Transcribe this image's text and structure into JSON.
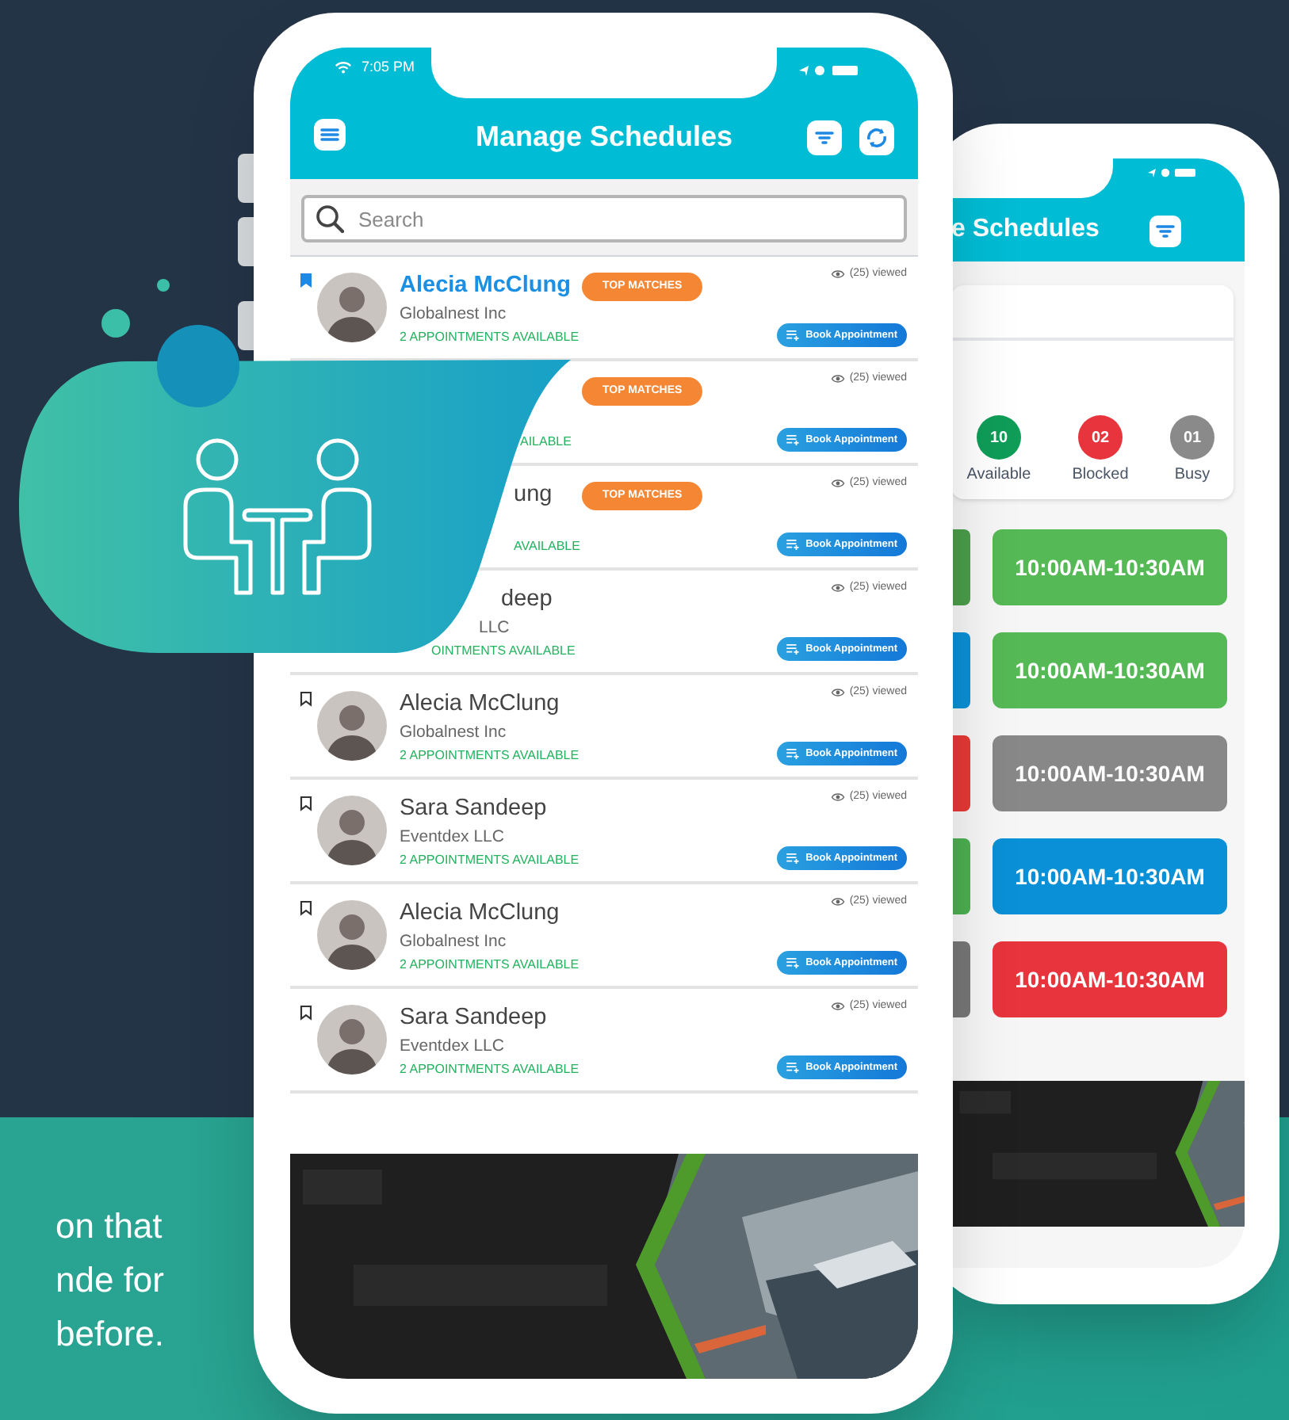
{
  "status_bar": {
    "time": "7:05 PM"
  },
  "header": {
    "title": "Manage Schedules"
  },
  "search": {
    "placeholder": "Search"
  },
  "contacts": [
    {
      "kind": "full",
      "bookmarked": true,
      "selected": true,
      "name": "Alecia McClung",
      "company": "Globalnest Inc",
      "appointments": "2 APPOINTMENTS AVAILABLE",
      "badge": "TOP MATCHES",
      "views": "(25) viewed",
      "action": "Book Appointment"
    },
    {
      "kind": "covered",
      "appointments": "AILABLE",
      "badge": "TOP MATCHES",
      "views": "(25) viewed",
      "action": "Book Appointment"
    },
    {
      "kind": "covered",
      "name": "ung",
      "appointments": "AVAILABLE",
      "badge": "TOP MATCHES",
      "views": "(25) viewed",
      "action": "Book Appointment"
    },
    {
      "kind": "covered",
      "name": "deep",
      "company": "LLC",
      "appointments": "OINTMENTS AVAILABLE",
      "views": "(25) viewed",
      "action": "Book Appointment"
    },
    {
      "kind": "full",
      "bookmarked": false,
      "selected": false,
      "name": "Alecia McClung",
      "company": "Globalnest Inc",
      "appointments": "2 APPOINTMENTS AVAILABLE",
      "views": "(25) viewed",
      "action": "Book Appointment"
    },
    {
      "kind": "full",
      "bookmarked": false,
      "selected": false,
      "name": "Sara Sandeep",
      "company": "Eventdex LLC",
      "appointments": "2 APPOINTMENTS AVAILABLE",
      "views": "(25) viewed",
      "action": "Book Appointment"
    },
    {
      "kind": "full",
      "bookmarked": false,
      "selected": false,
      "name": "Alecia McClung",
      "company": "Globalnest Inc",
      "appointments": "2 APPOINTMENTS AVAILABLE",
      "views": "(25) viewed",
      "action": "Book Appointment"
    },
    {
      "kind": "full",
      "bookmarked": false,
      "selected": false,
      "name": "Sara Sandeep",
      "company": "Eventdex LLC",
      "appointments": "2 APPOINTMENTS AVAILABLE",
      "views": "(25) viewed",
      "action": "Book Appointment"
    }
  ],
  "back_screen": {
    "title": "e Schedules",
    "stats": [
      {
        "count": "10",
        "label": "Available",
        "color": "#0f9d58"
      },
      {
        "count": "02",
        "label": "Blocked",
        "color": "#e8343c"
      },
      {
        "count": "01",
        "label": "Busy",
        "color": "#8a8a8a"
      }
    ],
    "partial_slots": [
      {
        "color": "#4a9e4a"
      },
      {
        "color": "#0a90d6"
      },
      {
        "color": "#e53935"
      },
      {
        "color": "#4caf50"
      },
      {
        "color": "#777777"
      }
    ],
    "slots": [
      {
        "label": "10:00AM-10:30AM",
        "color": "#55b955"
      },
      {
        "label": "10:00AM-10:30AM",
        "color": "#55b955"
      },
      {
        "label": "10:00AM-10:30AM",
        "color": "#888888"
      },
      {
        "label": "10:00AM-10:30AM",
        "color": "#0a90d6"
      },
      {
        "label": "10:00AM-10:30AM",
        "color": "#e8343c"
      }
    ]
  },
  "tagline": [
    "on that",
    "nde for",
    "before."
  ]
}
